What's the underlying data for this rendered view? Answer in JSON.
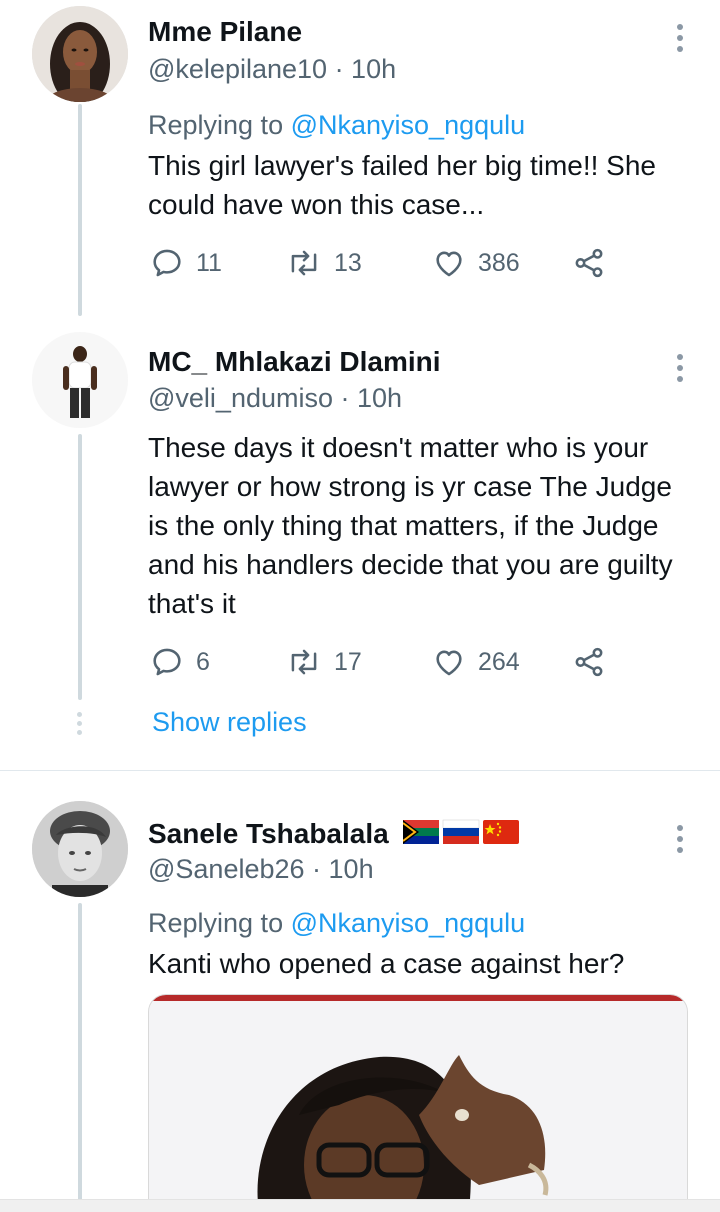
{
  "tweets": [
    {
      "name": "Mme Pilane",
      "handle": "@kelepilane10",
      "time": "· 10h",
      "replying_prefix": "Replying to ",
      "replying_mention": "@Nkanyiso_ngqulu",
      "text": "This girl lawyer's failed her big time!! She could have won this case...",
      "replies": "11",
      "retweets": "13",
      "likes": "386"
    },
    {
      "name": "MC_ Mhlakazi Dlamini",
      "handle": "@veli_ndumiso",
      "time": "· 10h",
      "text": "These days it doesn't matter who is your lawyer or how strong is yr case The Judge is the only thing that matters, if the Judge and his handlers decide that you are guilty that's it",
      "replies": "6",
      "retweets": "17",
      "likes": "264"
    },
    {
      "name": "Sanele Tshabalala",
      "handle": "@Saneleb26",
      "time": "· 10h",
      "replying_prefix": "Replying to ",
      "replying_mention": "@Nkanyiso_ngqulu",
      "text": "Kanti who opened a case against her?"
    }
  ],
  "show_replies": "Show replies",
  "flags": [
    "South Africa flag",
    "Russia flag",
    "China flag"
  ],
  "colors": {
    "link": "#1d9bf0",
    "secondary_text": "#536471",
    "thread_line": "#cfd9de"
  }
}
